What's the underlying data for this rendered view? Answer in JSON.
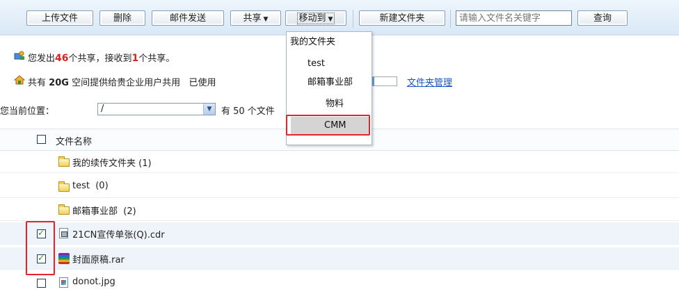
{
  "toolbar": {
    "upload": "上传文件",
    "delete": "删除",
    "email_send": "邮件发送",
    "share": "共享",
    "move_to": "移动到",
    "new_folder": "新建文件夹",
    "search_placeholder": "请输入文件名关键字",
    "search_button": "查询"
  },
  "share_info": {
    "prefix": "您发出",
    "sent_count": "46",
    "middle": "个共享，接收到",
    "received_count": "1",
    "suffix": "个共享。"
  },
  "space_info": {
    "prefix": "共有",
    "size": "20G",
    "text": "空间提供给贵企业用户共用",
    "used_label": "已使用",
    "used_fraction": 0.12,
    "folder_manage_link": "文件夹管理"
  },
  "location": {
    "label": "您当前位置：",
    "path": "/",
    "count_text": "有 50 个文件"
  },
  "list": {
    "header": "文件名称",
    "folders": [
      {
        "name": "我的续传文件夹",
        "count": "(1)"
      },
      {
        "name": "test",
        "count": "(0)"
      },
      {
        "name": "邮箱事业部",
        "count": "(2)"
      }
    ],
    "files": [
      {
        "name": "21CN宣传单张(Q).cdr",
        "checked": true,
        "icon": "cdr-file-icon"
      },
      {
        "name": "封面原稿.rar",
        "checked": true,
        "icon": "rar-archive-icon"
      },
      {
        "name": "donot.jpg",
        "checked": false,
        "icon": "image-file-icon"
      }
    ]
  },
  "move_menu": {
    "items": [
      "我的文件夹",
      "test",
      "邮箱事业部",
      "物料",
      "CMM"
    ],
    "highlighted": "CMM"
  },
  "colors": {
    "accent_red": "#e02020",
    "link_blue": "#1a55c4",
    "highlight_box": "#e4242a"
  }
}
